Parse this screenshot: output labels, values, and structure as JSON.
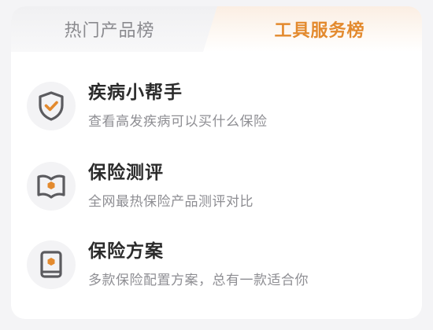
{
  "tabs": {
    "hot_products": "热门产品榜",
    "tool_services": "工具服务榜",
    "active": "tool_services"
  },
  "colors": {
    "accent": "#e38a2e",
    "icon_gray": "#5b5b5f",
    "title": "#2b2b2b",
    "desc": "#8e8e93"
  },
  "items": [
    {
      "icon": "shield-check-icon",
      "title": "疾病小帮手",
      "desc": "查看高发疾病可以买什么保险"
    },
    {
      "icon": "open-book-icon",
      "title": "保险测评",
      "desc": "全网最热保险产品测评对比"
    },
    {
      "icon": "book-icon",
      "title": "保险方案",
      "desc": "多款保险配置方案，总有一款适合你"
    }
  ]
}
